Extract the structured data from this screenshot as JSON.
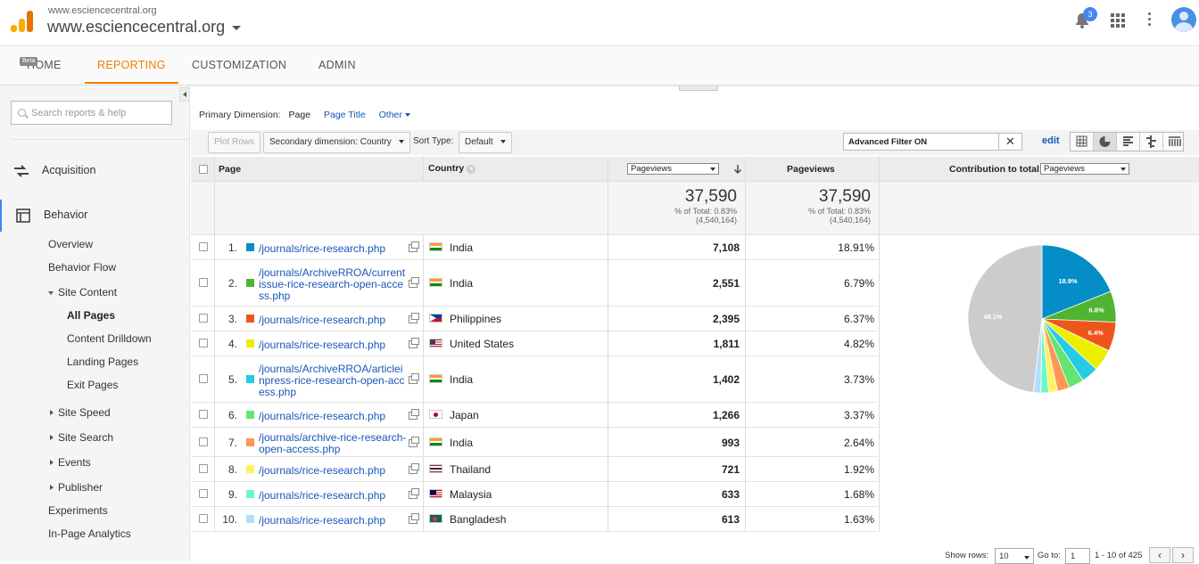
{
  "header": {
    "account_small": "www.esciencecentral.org",
    "account_big": "www.esciencecentral.org",
    "notifications_count": "3"
  },
  "nav": {
    "tabs": [
      {
        "label": "HOME",
        "badge": "Beta"
      },
      {
        "label": "REPORTING"
      },
      {
        "label": "CUSTOMIZATION"
      },
      {
        "label": "ADMIN"
      }
    ],
    "active": "REPORTING"
  },
  "sidebar": {
    "search_placeholder": "Search reports & help",
    "acquisition": "Acquisition",
    "behavior": "Behavior",
    "items": [
      "Overview",
      "Behavior Flow",
      "Site Content",
      "All Pages",
      "Content Drilldown",
      "Landing Pages",
      "Exit Pages",
      "Site Speed",
      "Site Search",
      "Events",
      "Publisher",
      "Experiments",
      "In-Page Analytics"
    ]
  },
  "dimension": {
    "label": "Primary Dimension:",
    "current": "Page",
    "page_title": "Page Title",
    "other": "Other"
  },
  "toolbar": {
    "plot_rows": "Plot Rows",
    "secondary": "Secondary dimension: Country",
    "sort_label": "Sort Type:",
    "sort_value": "Default",
    "filter_text": "Advanced Filter ON",
    "edit": "edit"
  },
  "table": {
    "col_page": "Page",
    "col_country": "Country",
    "metric_select": "Pageviews",
    "col_pageviews": "Pageviews",
    "contribution_label": "Contribution to total:",
    "contribution_select": "Pageviews",
    "totals": {
      "value1": "37,590",
      "pct1": "% of Total: 0.83%",
      "base1": "(4,540,164)",
      "value2": "37,590",
      "pct2": "% of Total: 0.83%",
      "base2": "(4,540,164)"
    },
    "rows": [
      {
        "n": "1.",
        "page": "/journals/rice-research.php",
        "country": "India",
        "pv": "7,108",
        "pct": "18.91%"
      },
      {
        "n": "2.",
        "page": "/journals/ArchiveRROA/current issue-rice-research-open-access.php",
        "country": "India",
        "pv": "2,551",
        "pct": "6.79%"
      },
      {
        "n": "3.",
        "page": "/journals/rice-research.php",
        "country": "Philippines",
        "pv": "2,395",
        "pct": "6.37%"
      },
      {
        "n": "4.",
        "page": "/journals/rice-research.php",
        "country": "United States",
        "pv": "1,811",
        "pct": "4.82%"
      },
      {
        "n": "5.",
        "page": "/journals/ArchiveRROA/articleinpress-rice-research-open-access.php",
        "country": "India",
        "pv": "1,402",
        "pct": "3.73%"
      },
      {
        "n": "6.",
        "page": "/journals/rice-research.php",
        "country": "Japan",
        "pv": "1,266",
        "pct": "3.37%"
      },
      {
        "n": "7.",
        "page": "/journals/archive-rice-research-open-access.php",
        "country": "India",
        "pv": "993",
        "pct": "2.64%"
      },
      {
        "n": "8.",
        "page": "/journals/rice-research.php",
        "country": "Thailand",
        "pv": "721",
        "pct": "1.92%"
      },
      {
        "n": "9.",
        "page": "/journals/rice-research.php",
        "country": "Malaysia",
        "pv": "633",
        "pct": "1.68%"
      },
      {
        "n": "10.",
        "page": "/journals/rice-research.php",
        "country": "Bangladesh",
        "pv": "613",
        "pct": "1.63%"
      }
    ],
    "swatch_colors": [
      "#058dc7",
      "#50b432",
      "#ed561b",
      "#edef00",
      "#24cbe5",
      "#64e572",
      "#ff9655",
      "#fff263",
      "#6af9c4",
      "#b2deff"
    ]
  },
  "pie": {
    "slices": [
      18.91,
      6.79,
      6.37,
      4.82,
      3.73,
      3.37,
      2.64,
      1.92,
      1.68,
      1.63,
      48.14
    ],
    "colors": [
      "#058dc7",
      "#50b432",
      "#ed561b",
      "#edef00",
      "#24cbe5",
      "#64e572",
      "#ff9655",
      "#fff263",
      "#6af9c4",
      "#b2deff",
      "#cccccc"
    ],
    "labels": [
      "18.9%",
      "6.8%",
      "6.4%",
      "48.1%"
    ]
  },
  "footer": {
    "show_rows_label": "Show rows:",
    "show_rows_value": "10",
    "goto_label": "Go to:",
    "goto_value": "1",
    "range": "1 - 10 of 425"
  }
}
